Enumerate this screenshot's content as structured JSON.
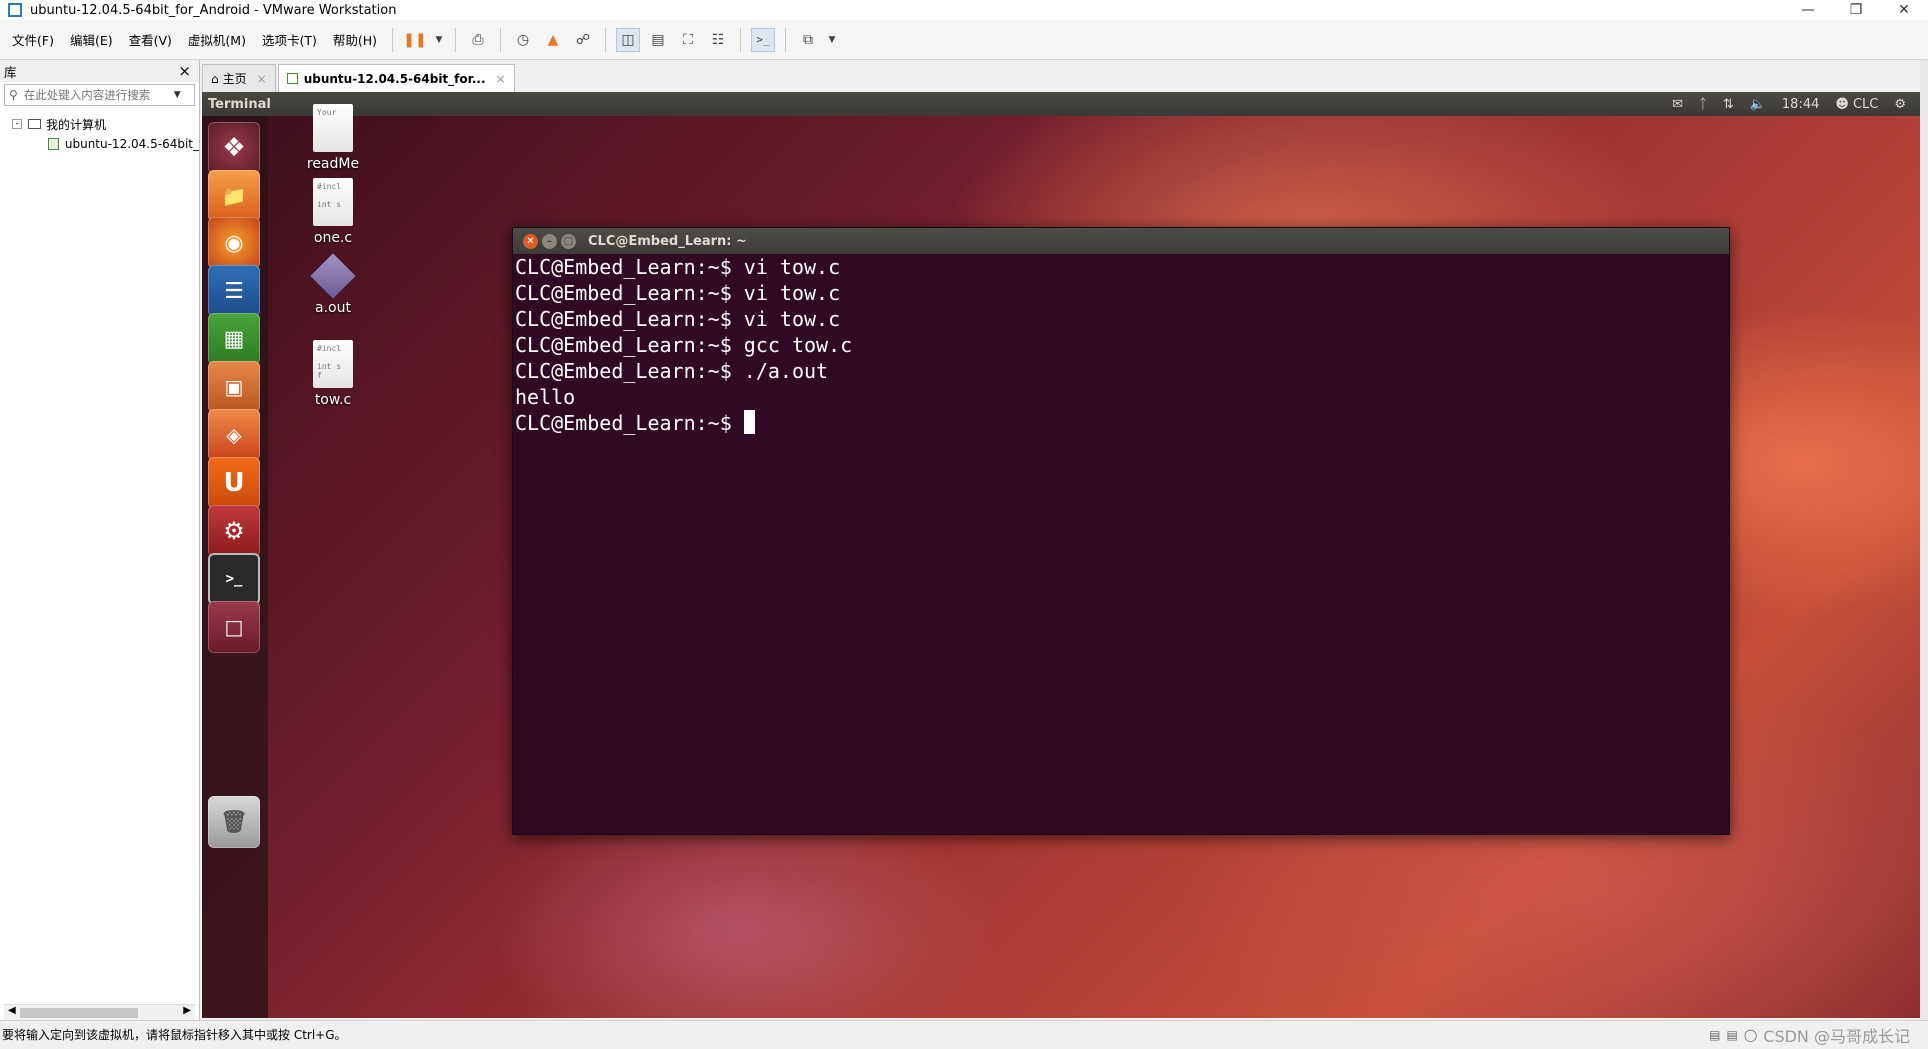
{
  "window": {
    "title": "ubuntu-12.04.5-64bit_for_Android - VMware Workstation",
    "minimize_icon": "minimize-icon",
    "restore_icon": "restore-icon",
    "close_icon": "close-icon"
  },
  "menu": {
    "items": [
      "文件(F)",
      "编辑(E)",
      "查看(V)",
      "虚拟机(M)",
      "选项卡(T)",
      "帮助(H)"
    ]
  },
  "library": {
    "title": "库",
    "close": "×",
    "search_placeholder": "在此处键入内容进行搜索",
    "tree_root": "我的计算机",
    "tree_child": "ubuntu-12.04.5-64bit_"
  },
  "tabs": [
    {
      "label": "主页",
      "close": "×"
    },
    {
      "label": "ubuntu-12.04.5-64bit_for...",
      "close": "×"
    }
  ],
  "ubuntu": {
    "panel_title": "Terminal",
    "clock": "18:44",
    "user": "CLC",
    "desktop_icons": [
      {
        "label": "readMe",
        "preview": "Your"
      },
      {
        "label": "one.c",
        "preview": "#incl\n\nint s"
      },
      {
        "label": "a.out",
        "preview": ""
      },
      {
        "label": "tow.c",
        "preview": "#incl\n\nint s\nf"
      }
    ]
  },
  "terminal": {
    "title": "CLC@Embed_Learn: ~",
    "lines": [
      "CLC@Embed_Learn:~$ vi tow.c",
      "CLC@Embed_Learn:~$ vi tow.c",
      "CLC@Embed_Learn:~$ vi tow.c",
      "CLC@Embed_Learn:~$ gcc tow.c",
      "CLC@Embed_Learn:~$ ./a.out",
      "hello"
    ],
    "prompt": "CLC@Embed_Learn:~$ "
  },
  "status": {
    "message": "要将输入定向到该虚拟机，请将鼠标指针移入其中或按 Ctrl+G。",
    "watermark": "CSDN @马哥成长记"
  },
  "colors": {
    "terminal_bg": "#300a24",
    "ubuntu_panel": "#3c3b37",
    "accent_orange": "#dd4814"
  }
}
